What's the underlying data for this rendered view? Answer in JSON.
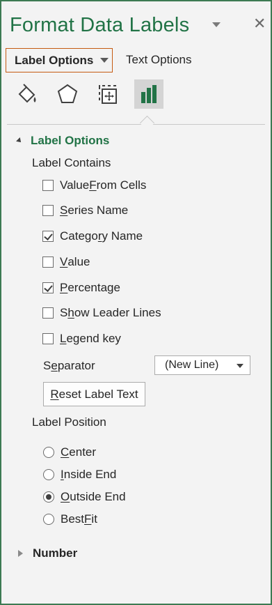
{
  "pane": {
    "title": "Format Data Labels",
    "tabs": {
      "label_options": "Label Options",
      "text_options": "Text Options"
    },
    "icons": [
      "fill-line-icon",
      "effects-pentagon-icon",
      "size-properties-icon",
      "label-options-bar-chart-icon"
    ]
  },
  "label_options_section": {
    "header": "Label Options",
    "label_contains": {
      "heading": "Label Contains",
      "items": [
        {
          "pre": "Value ",
          "key": "F",
          "post": "rom Cells",
          "checked": false
        },
        {
          "pre": "",
          "key": "S",
          "post": "eries Name",
          "checked": false
        },
        {
          "pre": "Catego",
          "key": "r",
          "post": "y Name",
          "checked": true
        },
        {
          "pre": "",
          "key": "V",
          "post": "alue",
          "checked": false
        },
        {
          "pre": "",
          "key": "P",
          "post": "ercentage",
          "checked": true
        },
        {
          "pre": "S",
          "key": "h",
          "post": "ow Leader Lines",
          "checked": false
        },
        {
          "pre": "",
          "key": "L",
          "post": "egend key",
          "checked": false
        }
      ]
    },
    "separator": {
      "pre": "S",
      "key": "e",
      "post": "parator",
      "value": "(New Line)"
    },
    "reset_button": {
      "pre": "",
      "key": "R",
      "post": "eset Label Text"
    },
    "label_position": {
      "heading": "Label Position",
      "items": [
        {
          "pre": "",
          "key": "C",
          "post": "enter",
          "selected": false
        },
        {
          "pre": "",
          "key": "I",
          "post": "nside End",
          "selected": false
        },
        {
          "pre": "",
          "key": "O",
          "post": "utside End",
          "selected": true
        },
        {
          "pre": "Best ",
          "key": "F",
          "post": "it",
          "selected": false
        }
      ]
    }
  },
  "number_section": {
    "header": "Number"
  },
  "colors": {
    "accent_green": "#217346",
    "tab_border": "#c55a11",
    "pane_bg": "#f3f3f3"
  }
}
